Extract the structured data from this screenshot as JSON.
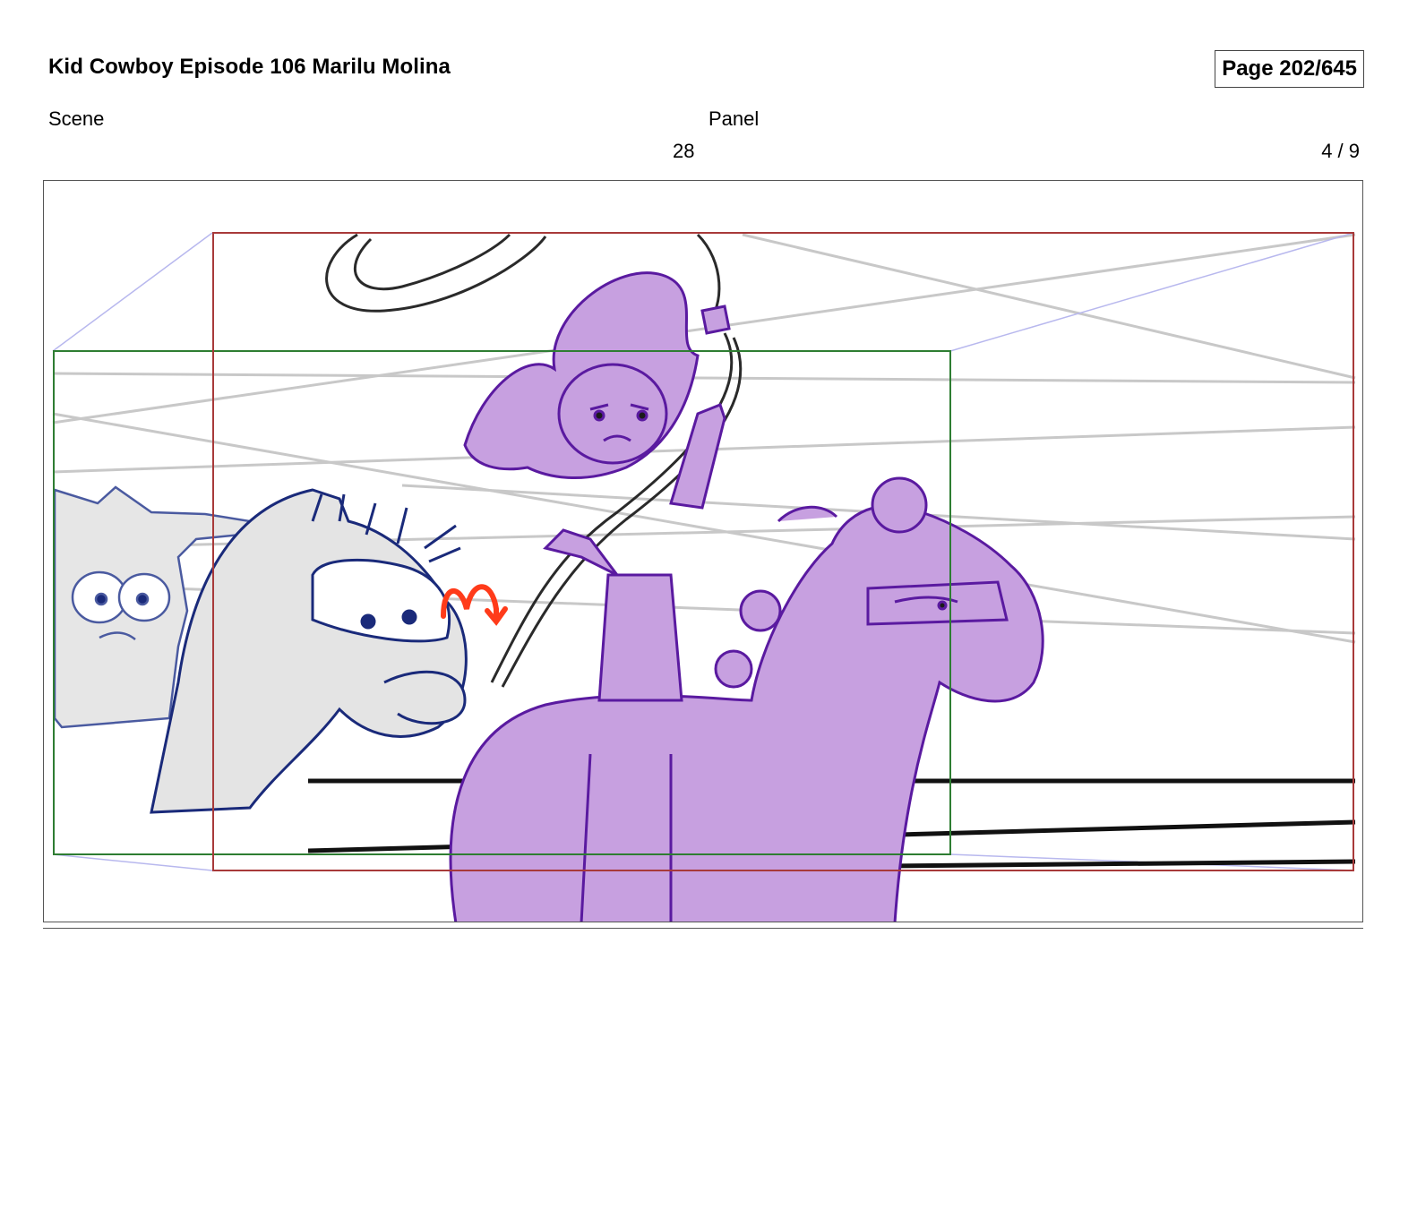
{
  "header": {
    "title": "Kid Cowboy Episode 106 Marilu Molina",
    "page": "Page 202/645"
  },
  "meta": {
    "scene_label": "Scene",
    "panel_label": "Panel",
    "scene_value": "28",
    "panel_value": "4 / 9"
  },
  "colors": {
    "safe_frame_red": "#a83a3a",
    "action_frame_green": "#2e7d32",
    "character_purple": "#c7a0e0",
    "outline_navy": "#1a2a7a",
    "annotation_orange": "#ff3b1a"
  }
}
